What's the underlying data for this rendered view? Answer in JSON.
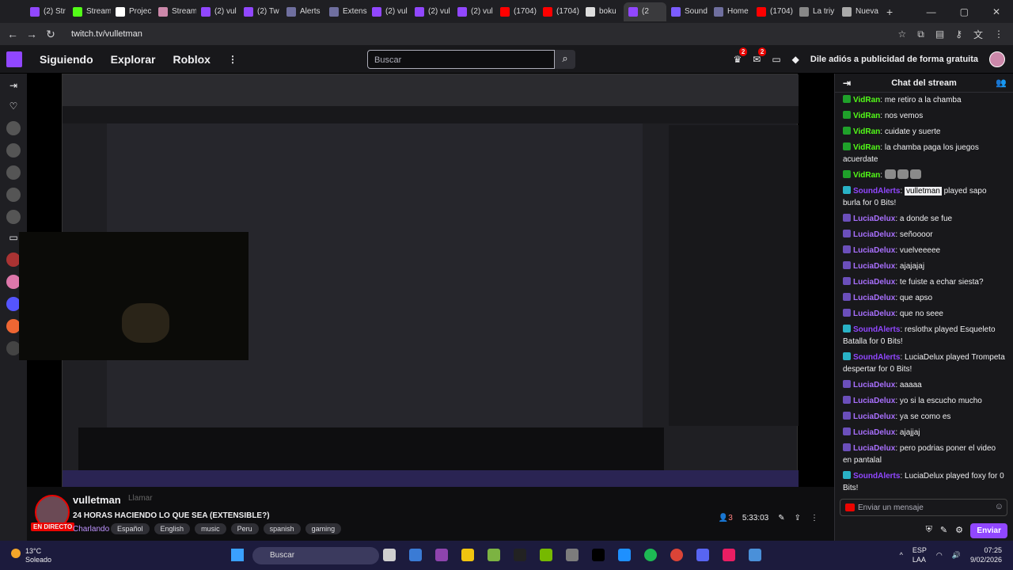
{
  "browser": {
    "tabs": [
      {
        "label": "(2) Str",
        "color": "#9147ff"
      },
      {
        "label": "Stream",
        "color": "#53fc18"
      },
      {
        "label": "Projec",
        "color": "#ffffff"
      },
      {
        "label": "Stream",
        "color": "#c8a"
      },
      {
        "label": "(2) vul",
        "color": "#9147ff"
      },
      {
        "label": "(2) Tw",
        "color": "#9147ff"
      },
      {
        "label": "Alerts",
        "color": "#6f6f9f"
      },
      {
        "label": "Extens",
        "color": "#6f6f9f"
      },
      {
        "label": "(2) vul",
        "color": "#9147ff"
      },
      {
        "label": "(2) vul",
        "color": "#9147ff"
      },
      {
        "label": "(2) vul",
        "color": "#9147ff"
      },
      {
        "label": "(1704)",
        "color": "#ff0000"
      },
      {
        "label": "(1704)",
        "color": "#ff0000"
      },
      {
        "label": "boku",
        "color": "#dddddd"
      },
      {
        "label": "(2",
        "color": "#9147ff"
      },
      {
        "label": "Sound",
        "color": "#7b5cff"
      },
      {
        "label": "Home",
        "color": "#6f6f9f"
      },
      {
        "label": "(1704)",
        "color": "#ff0000"
      },
      {
        "label": "La triy",
        "color": "#888888"
      },
      {
        "label": "Nueva",
        "color": "#aaaaaa"
      }
    ],
    "new_tab": "+",
    "url": "twitch.tv/vulletman"
  },
  "twitch": {
    "nav": [
      "Siguiendo",
      "Explorar",
      "Roblox"
    ],
    "search_placeholder": "Buscar",
    "notif_count_1": "2",
    "notif_count_2": "2",
    "ad_text": "Dile adiós a publicidad de forma gratuita"
  },
  "stream": {
    "channel": "vulletman",
    "follow": "Llamar",
    "title": "24 HORAS HACIENDO LO QUE SEA (EXTENSIBLE?)",
    "category": "Charlando",
    "tags": [
      "Español",
      "English",
      "music",
      "Peru",
      "spanish",
      "gaming"
    ],
    "live": "EN DIRECTO",
    "viewers": "3",
    "uptime": "5:33:03"
  },
  "chat": {
    "header": "Chat del stream",
    "messages": [
      {
        "user": "VidRan",
        "cls": "u1",
        "text": "me retiro a la chamba"
      },
      {
        "user": "VidRan",
        "cls": "u1",
        "text": "nos vemos"
      },
      {
        "user": "VidRan",
        "cls": "u1",
        "text": "cuidate y suerte"
      },
      {
        "user": "VidRan",
        "cls": "u1",
        "text": "la chamba paga los juegos acuerdate"
      },
      {
        "user": "VidRan",
        "cls": "u1",
        "text": "",
        "emotes": 3
      },
      {
        "user": "SoundAlerts",
        "cls": "u3",
        "mention": "vulletman",
        "text": " played sapo burla for 0 Bits!"
      },
      {
        "user": "LuciaDelux",
        "cls": "u2",
        "text": "a donde se fue"
      },
      {
        "user": "LuciaDelux",
        "cls": "u2",
        "text": "señoooor"
      },
      {
        "user": "LuciaDelux",
        "cls": "u2",
        "text": "vuelveeeee"
      },
      {
        "user": "LuciaDelux",
        "cls": "u2",
        "text": "ajajajaj"
      },
      {
        "user": "LuciaDelux",
        "cls": "u2",
        "text": "te fuiste a echar siesta?"
      },
      {
        "user": "LuciaDelux",
        "cls": "u2",
        "text": "que apso"
      },
      {
        "user": "LuciaDelux",
        "cls": "u2",
        "text": "que no seee"
      },
      {
        "user": "SoundAlerts",
        "cls": "u3",
        "text": "reslothx played Esqueleto Batalla for 0 Bits!"
      },
      {
        "user": "SoundAlerts",
        "cls": "u3",
        "text": "LuciaDelux played Trompeta despertar for 0 Bits!"
      },
      {
        "user": "LuciaDelux",
        "cls": "u2",
        "text": "aaaaa"
      },
      {
        "user": "LuciaDelux",
        "cls": "u2",
        "text": "yo si la escucho mucho"
      },
      {
        "user": "LuciaDelux",
        "cls": "u2",
        "text": "ya se como es"
      },
      {
        "user": "LuciaDelux",
        "cls": "u2",
        "text": "ajajjaj"
      },
      {
        "user": "LuciaDelux",
        "cls": "u2",
        "text": "pero podrias poner el video en pantalal"
      },
      {
        "user": "SoundAlerts",
        "cls": "u3",
        "text": "LuciaDelux played foxy for 0 Bits!"
      }
    ],
    "input_placeholder": "Enviar un mensaje",
    "send": "Enviar"
  },
  "taskbar": {
    "temp": "13°C",
    "weather": "Soleado",
    "search": "Buscar",
    "lang": "ESP",
    "region": "LAA",
    "time": "07:25",
    "date": "9/02/2026"
  }
}
